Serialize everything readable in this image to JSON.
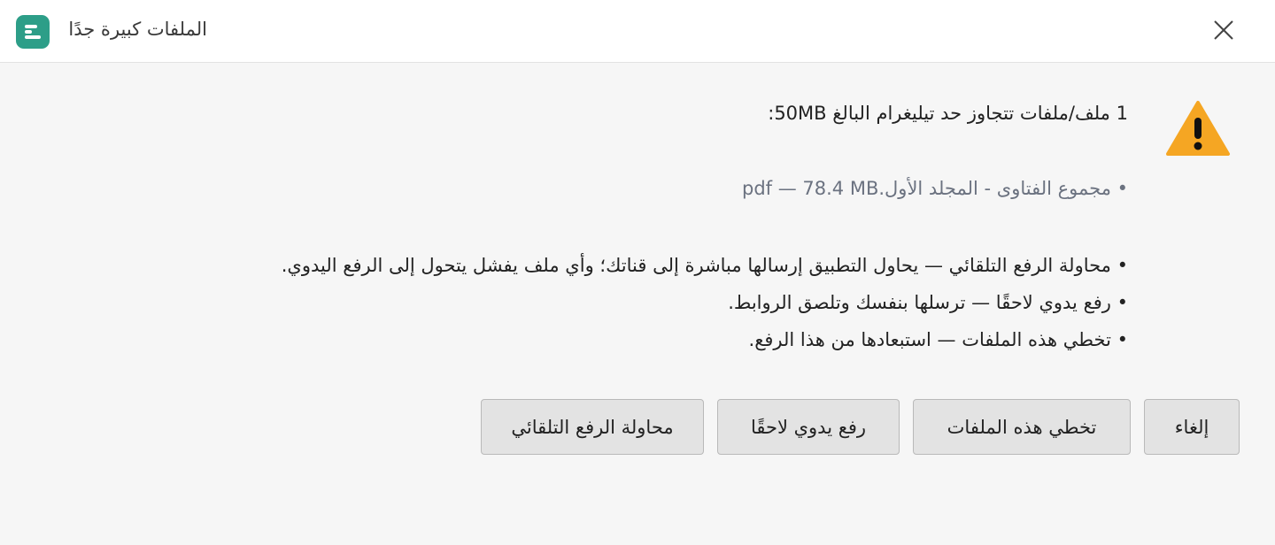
{
  "window": {
    "title": "الملفات كبيرة جدًا",
    "logo_icon": "app-logo-icon",
    "close_icon": "close-icon"
  },
  "message": {
    "heading": "1 ملف/ملفات تتجاوز حد تيليغرام البالغ 50MB:",
    "files": [
      "• مجموع الفتاوى - المجلد الأول.pdf — 78.4 MB"
    ],
    "options": [
      "• محاولة الرفع التلقائي — يحاول التطبيق إرسالها مباشرة إلى قناتك؛ وأي ملف يفشل يتحول إلى الرفع اليدوي.",
      "• رفع يدوي لاحقًا — ترسلها بنفسك وتلصق الروابط.",
      "• تخطي هذه الملفات — استبعادها من هذا الرفع."
    ],
    "icon": "warning-icon",
    "accent_color": "#f5a623"
  },
  "buttons": {
    "cancel": "إلغاء",
    "skip": "تخطي هذه الملفات",
    "manual": "رفع يدوي لاحقًا",
    "auto": "محاولة الرفع التلقائي"
  },
  "colors": {
    "brand": "#2d9e88",
    "warning": "#f5a623"
  }
}
